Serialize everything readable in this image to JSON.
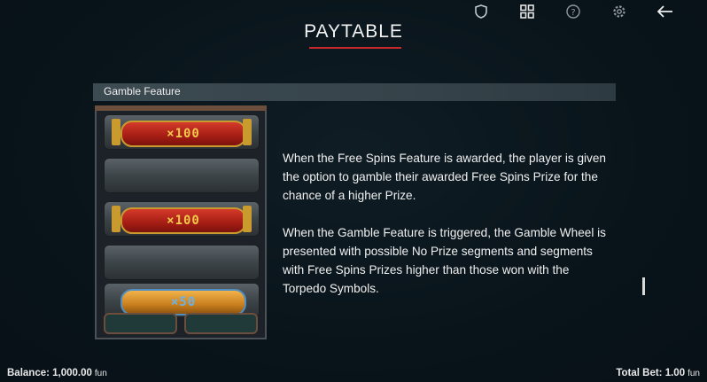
{
  "header": {
    "title": "PAYTABLE"
  },
  "toolbar": {
    "icons": [
      "shield-icon",
      "grid-icon",
      "help-icon",
      "settings-icon",
      "back-arrow-icon"
    ]
  },
  "section": {
    "title": "Gamble Feature"
  },
  "rack": {
    "slots": [
      {
        "label": "×100",
        "style": "red"
      },
      {
        "label": "",
        "style": "empty"
      },
      {
        "label": "×100",
        "style": "red"
      },
      {
        "label": "",
        "style": "empty"
      },
      {
        "label": "×50",
        "style": "gold"
      }
    ]
  },
  "content": {
    "paragraph1": "When the Free Spins Feature is awarded, the player is given the option to gamble their awarded Free Spins Prize for the chance of a higher Prize.",
    "paragraph2": "When the Gamble Feature is triggered, the Gamble Wheel is presented with possible No Prize segments and segments with Free Spins Prizes higher than those won with the Torpedo Symbols."
  },
  "footer": {
    "balance_label": "Balance:",
    "balance_value": "1,000.00",
    "balance_unit": "fun",
    "bet_label": "Total Bet:",
    "bet_value": "1.00",
    "bet_unit": "fun"
  }
}
